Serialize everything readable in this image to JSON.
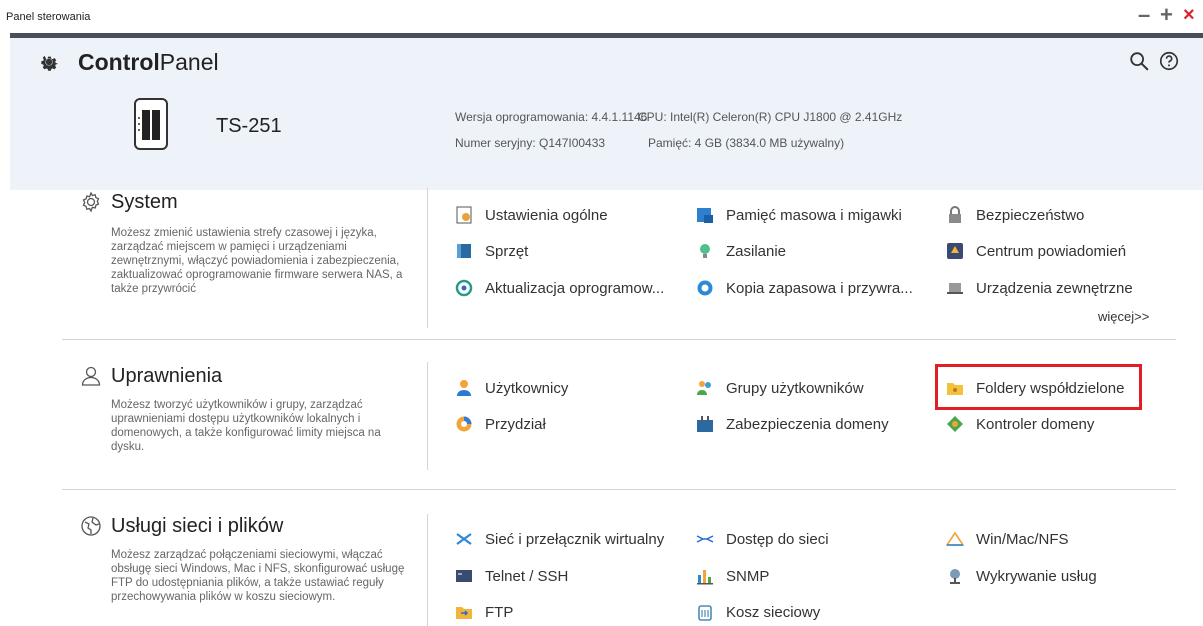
{
  "window": {
    "title": "Panel sterowania",
    "min": "–",
    "max": "+",
    "close": "×"
  },
  "header": {
    "app_title_bold": "Control",
    "app_title_light": "Panel",
    "model": "TS-251",
    "firmware": "Wersja oprogramowania: 4.4.1.1146",
    "serial": "Numer seryjny: Q147I00433",
    "cpu": "CPU:  Intel(R) Celeron(R) CPU J1800 @ 2.41GHz",
    "memory": "Pamięć:  4 GB (3834.0 MB używalny)"
  },
  "system": {
    "title": "System",
    "description": "Możesz zmienić ustawienia strefy czasowej i języka, zarządzać miejscem w pamięci i urządzeniami zewnętrznymi, włączyć powiadomienia i zabezpieczenia, zaktualizować oprogramowanie firmware serwera NAS, a także przywrócić",
    "items": [
      {
        "label": "Ustawienia ogólne",
        "icon": "general-settings-icon"
      },
      {
        "label": "Pamięć masowa i migawki",
        "icon": "storage-snapshots-icon"
      },
      {
        "label": "Bezpieczeństwo",
        "icon": "lock-icon"
      },
      {
        "label": "Sprzęt",
        "icon": "hardware-icon"
      },
      {
        "label": "Zasilanie",
        "icon": "power-bulb-icon"
      },
      {
        "label": "Centrum powiadomień",
        "icon": "notification-center-icon"
      },
      {
        "label": "Aktualizacja oprogramow...",
        "icon": "firmware-update-icon"
      },
      {
        "label": "Kopia zapasowa i przywra...",
        "icon": "backup-restore-icon"
      },
      {
        "label": "Urządzenia zewnętrzne",
        "icon": "external-device-icon"
      }
    ],
    "more": "więcej>>"
  },
  "privilege": {
    "title": "Uprawnienia",
    "description": "Możesz tworzyć użytkowników i grupy, zarządzać uprawnieniami dostępu użytkowników lokalnych i domenowych, a także konfigurować limity miejsca na dysku.",
    "items": [
      {
        "label": "Użytkownicy",
        "icon": "user-icon"
      },
      {
        "label": "Grupy użytkowników",
        "icon": "user-group-icon"
      },
      {
        "label": "Foldery współdzielone",
        "icon": "shared-folder-icon"
      },
      {
        "label": "Przydział",
        "icon": "quota-icon"
      },
      {
        "label": "Zabezpieczenia domeny",
        "icon": "domain-security-icon"
      },
      {
        "label": "Kontroler domeny",
        "icon": "domain-controller-icon"
      }
    ]
  },
  "network": {
    "title": "Usługi sieci i plików",
    "description": "Możesz zarządzać połączeniami sieciowymi, włączać obsługę sieci Windows, Mac i NFS, skonfigurować usługę FTP do udostępniania plików, a także ustawiać reguły przechowywania plików w koszu sieciowym.",
    "items": [
      {
        "label": "Sieć i przełącznik wirtualny",
        "icon": "network-switch-icon"
      },
      {
        "label": "Dostęp do sieci",
        "icon": "network-access-icon"
      },
      {
        "label": "Win/Mac/NFS",
        "icon": "win-mac-nfs-icon"
      },
      {
        "label": "Telnet / SSH",
        "icon": "terminal-icon"
      },
      {
        "label": "SNMP",
        "icon": "snmp-icon"
      },
      {
        "label": "Wykrywanie usług",
        "icon": "service-discovery-icon"
      },
      {
        "label": "FTP",
        "icon": "ftp-icon"
      },
      {
        "label": "Kosz sieciowy",
        "icon": "recycle-bin-icon"
      }
    ]
  },
  "colors": {
    "accent_line": "#4a4e57",
    "header_bg": "#eef3fa",
    "highlight": "#e01e26"
  }
}
